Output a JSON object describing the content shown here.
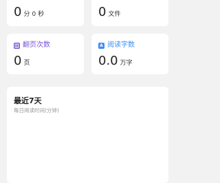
{
  "cards": {
    "reading_time": {
      "value_min": "0",
      "unit_min": "分",
      "value_sec": "0",
      "unit_sec": "秒",
      "icon_color": "#f5a030",
      "label_color": "#f5a030"
    },
    "downloaded": {
      "value": "0",
      "unit": "文件",
      "icon_color": "#3cc06a",
      "label_color": "#3cc06a"
    },
    "page_turns": {
      "label": "翻页次数",
      "value": "0",
      "unit": "页",
      "icon": "book-icon",
      "icon_color": "#7b55d8",
      "label_color": "#7b55d8"
    },
    "words_read": {
      "label": "阅读字数",
      "value": "0.0",
      "unit": "万字",
      "icon": "letter-a-icon",
      "icon_glyph": "A",
      "icon_color": "#3b8ef5",
      "label_color": "#3b8ef5"
    }
  },
  "weekly": {
    "title": "最近7天",
    "subtitle": "每日阅读时间(分钟)"
  }
}
